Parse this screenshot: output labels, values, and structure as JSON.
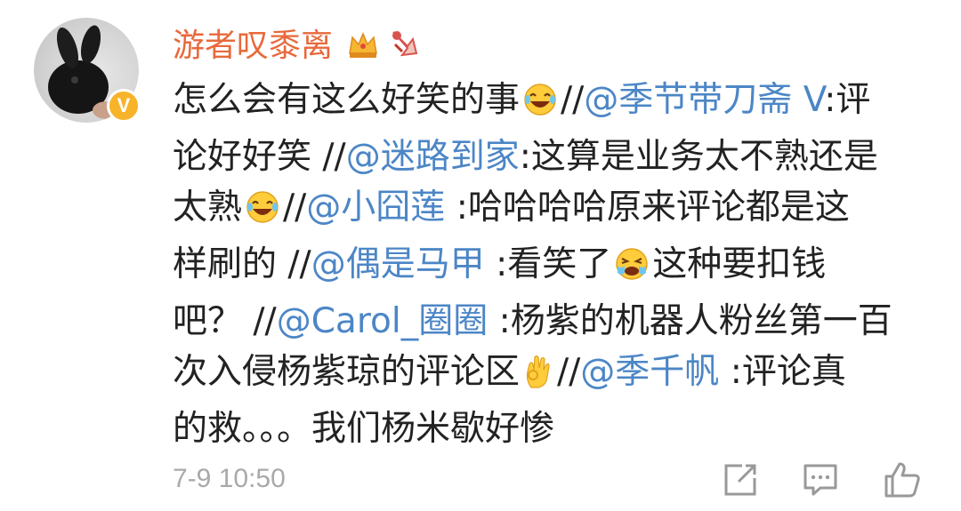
{
  "user": {
    "name": "游者叹黍离"
  },
  "comment": {
    "line1": {
      "t1": "怎么会有这么好笑的事",
      "t2": "//",
      "m1": "@季节带刀斋 V",
      "t3": ":评"
    },
    "line2": {
      "t1": "论好好笑 //",
      "m1": "@迷路到家",
      "t2": ":这算是业务太不熟还是"
    },
    "line3": {
      "t1": "太熟",
      "t2": "//",
      "m1": "@小囧莲",
      "t3": " :哈哈哈哈原来评论都是这"
    },
    "line4": {
      "t1": "样刷的 //",
      "m1": "@偶是马甲",
      "t2": " :看笑了",
      "t3": "这种要扣钱"
    },
    "line5": {
      "t1": "吧？ //",
      "m1": "@Carol_圈圈",
      "t2": " :杨紫的机器人粉丝第一百"
    },
    "line6": {
      "t1": "次入侵杨紫琼的评论区",
      "t2": "//",
      "m1": "@季千帆",
      "t3": " :评论真"
    },
    "line7": {
      "t1": "的救。。。我们杨米歇好惨"
    }
  },
  "footer": {
    "timestamp": "7-9 10:50"
  },
  "icons": [
    "verified-v-badge-icon",
    "crown-badge-icon",
    "fan-badge-icon",
    "laughing-emoji-icon",
    "crying-emoji-icon",
    "ok-hand-emoji-icon",
    "share-icon",
    "comment-icon",
    "like-icon"
  ],
  "colors": {
    "username": "#e8693b",
    "mention": "#4c86c6",
    "text": "#222222",
    "timestamp": "#a9a9a9",
    "vbadge": "#f7b32a"
  }
}
